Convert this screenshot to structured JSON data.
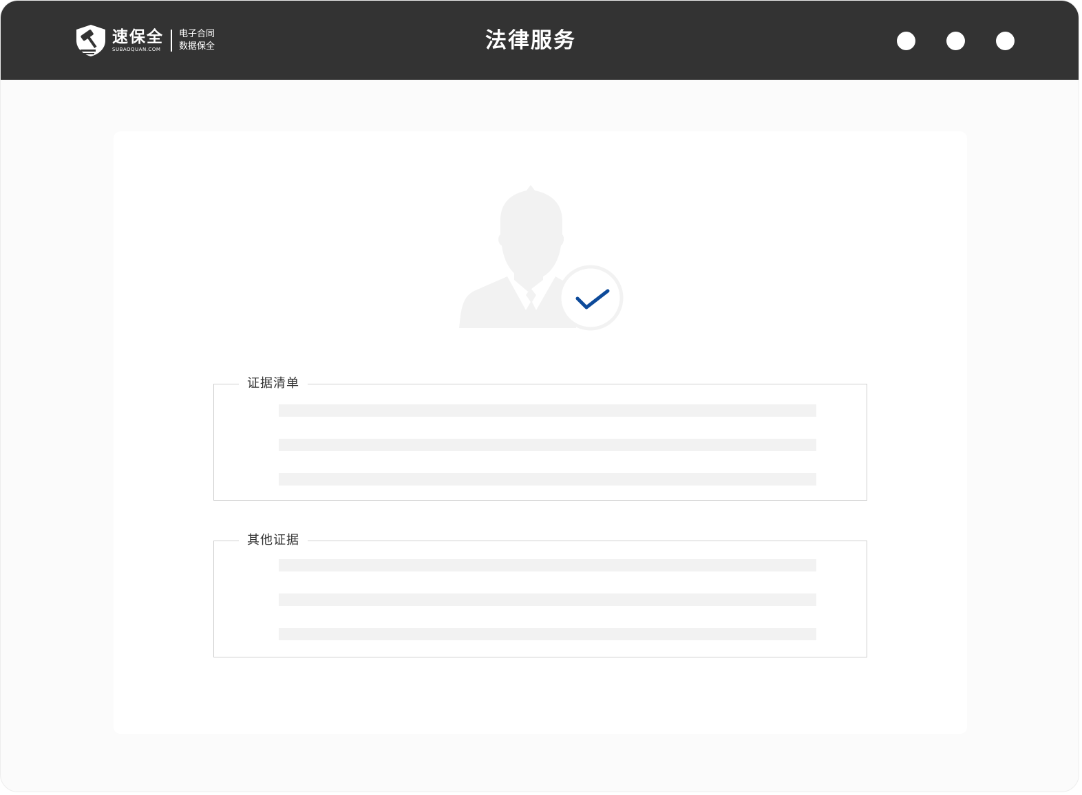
{
  "header": {
    "brand_name": "速保全",
    "brand_domain": "SUBAOQUAN.COM",
    "slogan_line1": "电子合同",
    "slogan_line2": "数据保全",
    "title": "法律服务"
  },
  "window_controls": [
    "dot",
    "dot",
    "dot"
  ],
  "avatar": {
    "icon": "verified-user-icon",
    "badge_icon": "checkmark-icon",
    "check_color": "#0d4a9a"
  },
  "sections": [
    {
      "label": "证据清单",
      "line_count": 3
    },
    {
      "label": "其他证据",
      "line_count": 3
    }
  ],
  "colors": {
    "titlebar": "#333333",
    "placeholder": "#f2f2f2",
    "border": "#cfcfcf",
    "accent": "#0d4a9a"
  }
}
